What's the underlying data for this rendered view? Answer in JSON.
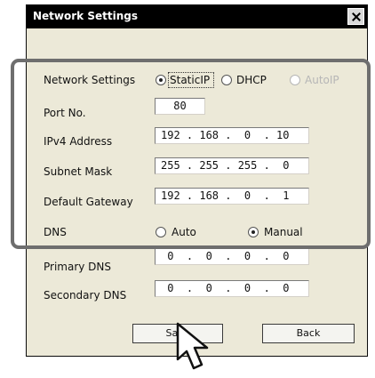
{
  "window": {
    "title": "Network Settings"
  },
  "rows": {
    "network_settings_label": "Network Settings",
    "port_label": "Port No.",
    "ipv4_label": "IPv4 Address",
    "subnet_label": "Subnet Mask",
    "gateway_label": "Default Gateway",
    "dns_label": "DNS",
    "primary_dns_label": "Primary DNS",
    "secondary_dns_label": "Secondary DNS"
  },
  "mode_options": {
    "static_ip": "StaticIP",
    "dhcp": "DHCP",
    "auto_ip": "AutoIP",
    "selected": "StaticIP"
  },
  "values": {
    "port": "80",
    "ipv4": "192 . 168 .  0  . 10",
    "subnet": "255 . 255 . 255 .  0",
    "gateway": "192 . 168 .  0  .  1",
    "primary_dns": " 0  .  0  .  0  .  0",
    "secondary_dns": " 0  .  0  .  0  .  0"
  },
  "dns_options": {
    "auto": "Auto",
    "manual": "Manual",
    "selected": "Manual"
  },
  "buttons": {
    "save": "Save",
    "back": "Back"
  },
  "icons": {
    "close": "close-icon",
    "cursor": "mouse-pointer-icon"
  },
  "colors": {
    "title_bar": "#000000",
    "window_bg": "#ece9d8",
    "highlight_frame": "#6e6e6e"
  }
}
